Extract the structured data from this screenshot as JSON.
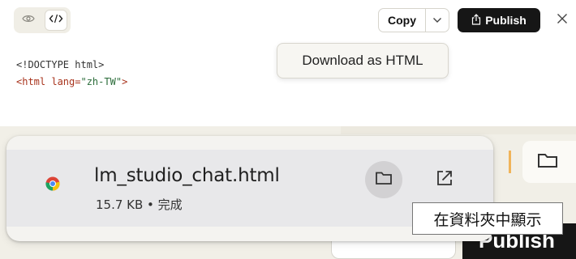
{
  "toolbar": {
    "copy_label": "Copy",
    "publish_label": "Publish",
    "download_tooltip": "Download as HTML"
  },
  "code": {
    "line1": "<!DOCTYPE html>",
    "line2_tag": "<html ",
    "line2_attr": "lang=",
    "line2_val": "\"zh-TW\"",
    "line2_end": ">"
  },
  "download": {
    "file_name": "lm_studio_chat.html",
    "file_meta": "15.7 KB • 完成",
    "show_in_folder_tooltip": "在資料夾中顯示"
  },
  "background_window": {
    "publish_label": "Publish"
  },
  "colors": {
    "accent_dark": "#161616",
    "toggle_bg": "#f0eee6",
    "card_bg": "#f4f3f0",
    "item_bg": "#e8e8ea",
    "folder_btn_bg": "#d2d1d3"
  },
  "icons": [
    "eye-icon",
    "code-icon",
    "chevron-down-icon",
    "share-icon",
    "close-icon",
    "chrome-icon",
    "folder-icon",
    "open-external-icon"
  ]
}
